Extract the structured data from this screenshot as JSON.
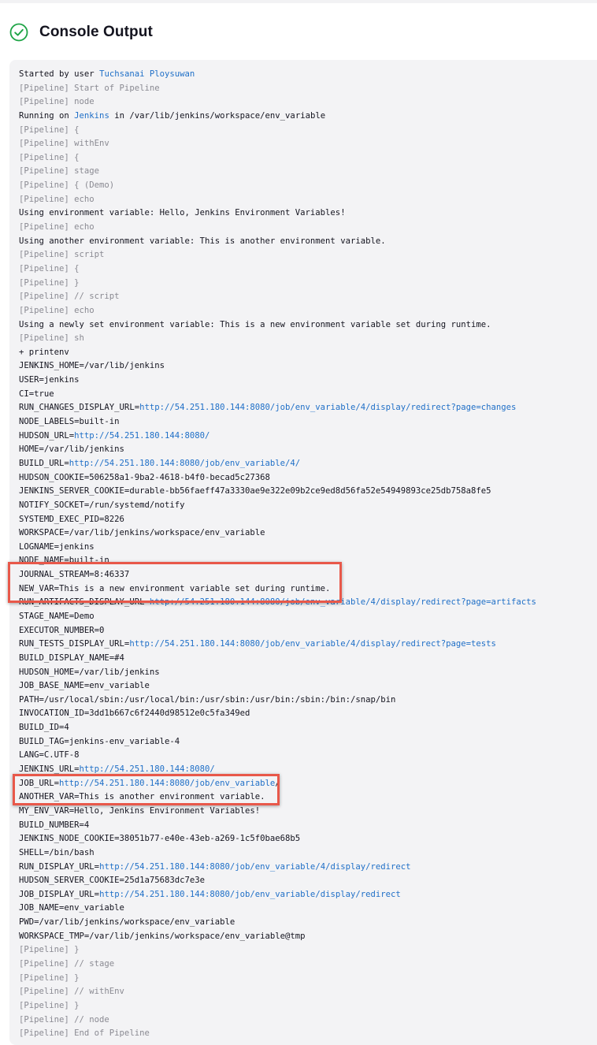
{
  "header": {
    "title": "Console Output",
    "status_icon": "success-check-icon",
    "status_color": "#1ea446"
  },
  "colors": {
    "pipeline_prefix": "#8a8a92",
    "link": "#1f6fc7",
    "highlight": "#e8584a"
  },
  "log": [
    [
      {
        "t": "Started by user "
      },
      {
        "t": "Tuchsanai Ploysuwan",
        "c": "link"
      }
    ],
    [
      {
        "t": "[Pipeline] Start of Pipeline",
        "c": "pipe"
      }
    ],
    [
      {
        "t": "[Pipeline] node",
        "c": "pipe"
      }
    ],
    [
      {
        "t": "Running on "
      },
      {
        "t": "Jenkins",
        "c": "link"
      },
      {
        "t": " in /var/lib/jenkins/workspace/env_variable"
      }
    ],
    [
      {
        "t": "[Pipeline] {",
        "c": "pipe"
      }
    ],
    [
      {
        "t": "[Pipeline] withEnv",
        "c": "pipe"
      }
    ],
    [
      {
        "t": "[Pipeline] {",
        "c": "pipe"
      }
    ],
    [
      {
        "t": "[Pipeline] stage",
        "c": "pipe"
      }
    ],
    [
      {
        "t": "[Pipeline] { (Demo)",
        "c": "pipe"
      }
    ],
    [
      {
        "t": "[Pipeline] echo",
        "c": "pipe"
      }
    ],
    [
      {
        "t": "Using environment variable: Hello, Jenkins Environment Variables!"
      }
    ],
    [
      {
        "t": "[Pipeline] echo",
        "c": "pipe"
      }
    ],
    [
      {
        "t": "Using another environment variable: This is another environment variable."
      }
    ],
    [
      {
        "t": "[Pipeline] script",
        "c": "pipe"
      }
    ],
    [
      {
        "t": "[Pipeline] {",
        "c": "pipe"
      }
    ],
    [
      {
        "t": "[Pipeline] }",
        "c": "pipe"
      }
    ],
    [
      {
        "t": "[Pipeline] // script",
        "c": "pipe"
      }
    ],
    [
      {
        "t": "[Pipeline] echo",
        "c": "pipe"
      }
    ],
    [
      {
        "t": "Using a newly set environment variable: This is a new environment variable set during runtime."
      }
    ],
    [
      {
        "t": "[Pipeline] sh",
        "c": "pipe"
      }
    ],
    [
      {
        "t": "+ printenv"
      }
    ],
    [
      {
        "t": "JENKINS_HOME=/var/lib/jenkins"
      }
    ],
    [
      {
        "t": "USER=jenkins"
      }
    ],
    [
      {
        "t": "CI=true"
      }
    ],
    [
      {
        "t": "RUN_CHANGES_DISPLAY_URL="
      },
      {
        "t": "http://54.251.180.144:8080/job/env_variable/4/display/redirect?page=changes",
        "c": "link"
      }
    ],
    [
      {
        "t": "NODE_LABELS=built-in"
      }
    ],
    [
      {
        "t": "HUDSON_URL="
      },
      {
        "t": "http://54.251.180.144:8080/",
        "c": "link"
      }
    ],
    [
      {
        "t": "HOME=/var/lib/jenkins"
      }
    ],
    [
      {
        "t": "BUILD_URL="
      },
      {
        "t": "http://54.251.180.144:8080/job/env_variable/4/",
        "c": "link"
      }
    ],
    [
      {
        "t": "HUDSON_COOKIE=506258a1-9ba2-4618-b4f0-becad5c27368"
      }
    ],
    [
      {
        "t": "JENKINS_SERVER_COOKIE=durable-bb56faeff47a3330ae9e322e09b2ce9ed8d56fa52e54949893ce25db758a8fe5"
      }
    ],
    [
      {
        "t": "NOTIFY_SOCKET=/run/systemd/notify"
      }
    ],
    [
      {
        "t": "SYSTEMD_EXEC_PID=8226"
      }
    ],
    [
      {
        "t": "WORKSPACE=/var/lib/jenkins/workspace/env_variable"
      }
    ],
    [
      {
        "t": "LOGNAME=jenkins"
      }
    ],
    [
      {
        "t": "NODE_NAME=built-in"
      }
    ],
    [
      {
        "t": "JOURNAL_STREAM=8:46337"
      }
    ],
    [
      {
        "t": "NEW_VAR=This is a new environment variable set during runtime."
      }
    ],
    [
      {
        "t": "RUN_ARTIFACTS_DISPLAY_URL="
      },
      {
        "t": "http://54.251.180.144:8080/job/env_variable/4/display/redirect?page=artifacts",
        "c": "link"
      }
    ],
    [
      {
        "t": "STAGE_NAME=Demo"
      }
    ],
    [
      {
        "t": "EXECUTOR_NUMBER=0"
      }
    ],
    [
      {
        "t": "RUN_TESTS_DISPLAY_URL="
      },
      {
        "t": "http://54.251.180.144:8080/job/env_variable/4/display/redirect?page=tests",
        "c": "link"
      }
    ],
    [
      {
        "t": "BUILD_DISPLAY_NAME=#4"
      }
    ],
    [
      {
        "t": "HUDSON_HOME=/var/lib/jenkins"
      }
    ],
    [
      {
        "t": "JOB_BASE_NAME=env_variable"
      }
    ],
    [
      {
        "t": "PATH=/usr/local/sbin:/usr/local/bin:/usr/sbin:/usr/bin:/sbin:/bin:/snap/bin"
      }
    ],
    [
      {
        "t": "INVOCATION_ID=3dd1b667c6f2440d98512e0c5fa349ed"
      }
    ],
    [
      {
        "t": "BUILD_ID=4"
      }
    ],
    [
      {
        "t": "BUILD_TAG=jenkins-env_variable-4"
      }
    ],
    [
      {
        "t": "LANG=C.UTF-8"
      }
    ],
    [
      {
        "t": "JENKINS_URL="
      },
      {
        "t": "http://54.251.180.144:8080/",
        "c": "link"
      }
    ],
    [
      {
        "t": "JOB_URL="
      },
      {
        "t": "http://54.251.180.144:8080/job/env_variable",
        "c": "link"
      },
      {
        "t": "/"
      }
    ],
    [
      {
        "t": "ANOTHER_VAR=This is another environment variable."
      }
    ],
    [
      {
        "t": "MY_ENV_VAR=Hello, Jenkins Environment Variables!"
      }
    ],
    [
      {
        "t": "BUILD_NUMBER=4"
      }
    ],
    [
      {
        "t": "JENKINS_NODE_COOKIE=38051b77-e40e-43eb-a269-1c5f0bae68b5"
      }
    ],
    [
      {
        "t": "SHELL=/bin/bash"
      }
    ],
    [
      {
        "t": "RUN_DISPLAY_URL="
      },
      {
        "t": "http://54.251.180.144:8080/job/env_variable/4/display/redirect",
        "c": "link"
      }
    ],
    [
      {
        "t": "HUDSON_SERVER_COOKIE=25d1a75683dc7e3e"
      }
    ],
    [
      {
        "t": "JOB_DISPLAY_URL="
      },
      {
        "t": "http://54.251.180.144:8080/job/env_variable/display/redirect",
        "c": "link"
      }
    ],
    [
      {
        "t": "JOB_NAME=env_variable"
      }
    ],
    [
      {
        "t": "PWD=/var/lib/jenkins/workspace/env_variable"
      }
    ],
    [
      {
        "t": "WORKSPACE_TMP=/var/lib/jenkins/workspace/env_variable@tmp"
      }
    ],
    [
      {
        "t": "[Pipeline] }",
        "c": "pipe"
      }
    ],
    [
      {
        "t": "[Pipeline] // stage",
        "c": "pipe"
      }
    ],
    [
      {
        "t": "[Pipeline] }",
        "c": "pipe"
      }
    ],
    [
      {
        "t": "[Pipeline] // withEnv",
        "c": "pipe"
      }
    ],
    [
      {
        "t": "[Pipeline] }",
        "c": "pipe"
      }
    ],
    [
      {
        "t": "[Pipeline] // node",
        "c": "pipe"
      }
    ],
    [
      {
        "t": "[Pipeline] End of Pipeline",
        "c": "pipe"
      }
    ]
  ]
}
